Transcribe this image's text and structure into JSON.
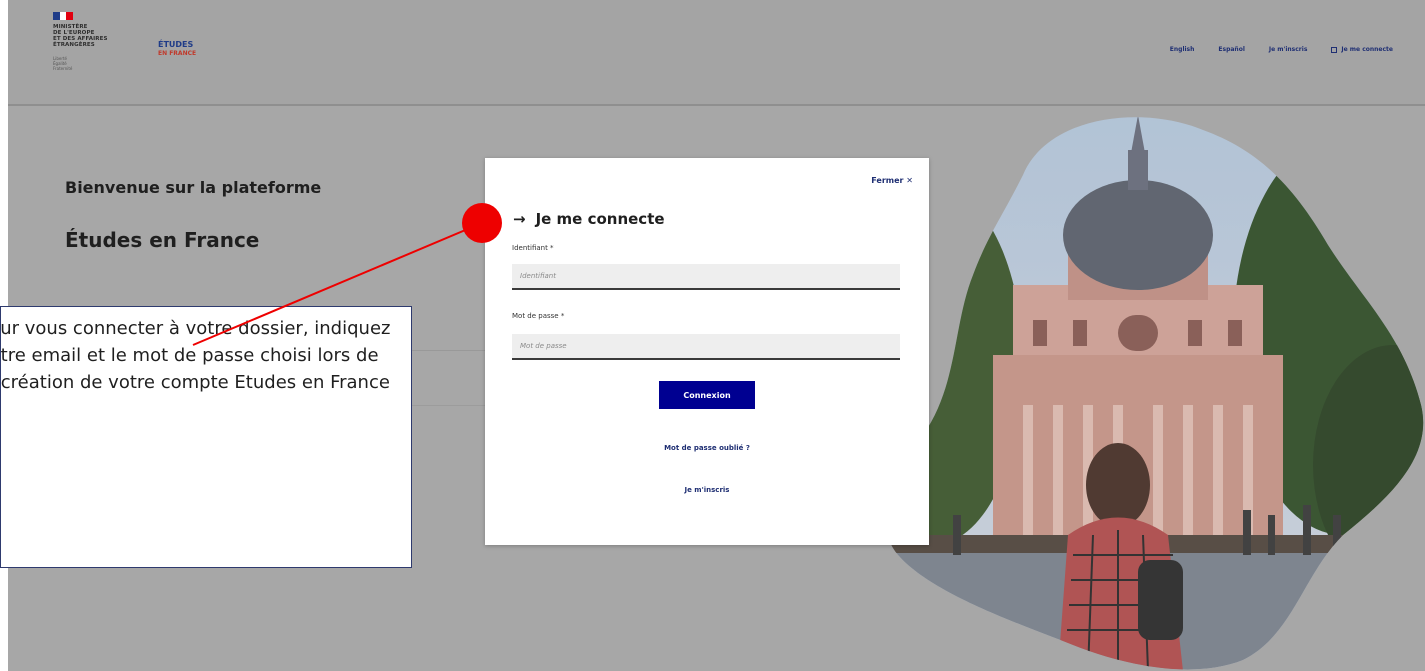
{
  "header": {
    "ministry_lines": [
      "MINISTÈRE",
      "DE L'EUROPE",
      "ET DES AFFAIRES",
      "ÉTRANGÈRES"
    ],
    "motto_lines": [
      "Liberté",
      "Égalité",
      "Fraternité"
    ],
    "brand_top": "ÉTUDES",
    "brand_bottom": "EN FRANCE",
    "nav": {
      "english": "English",
      "espanol": "Español",
      "signup": "Je m'inscris",
      "login": "Je me connecte"
    }
  },
  "main": {
    "welcome": "Bienvenue sur la plateforme",
    "platform_name": "Études en France"
  },
  "modal": {
    "close_label": "Fermer ✕",
    "title": "Je me connecte",
    "identifier_label": "Identifiant *",
    "identifier_placeholder": "Identifiant",
    "password_label": "Mot de passe *",
    "password_placeholder": "Mot de passe",
    "submit_label": "Connexion",
    "forgot_link": "Mot de passe oublié ?",
    "signup_link": "Je m'inscris"
  },
  "annotation": {
    "text": "Pour vous connecter à votre dossier, indiquez votre email et le mot de passe choisi lors de la création de votre compte Etudes en France"
  },
  "colors": {
    "primary_blue": "#000091",
    "annotation_red": "#ee0000",
    "overlay_gray": "#a7a7a7"
  }
}
